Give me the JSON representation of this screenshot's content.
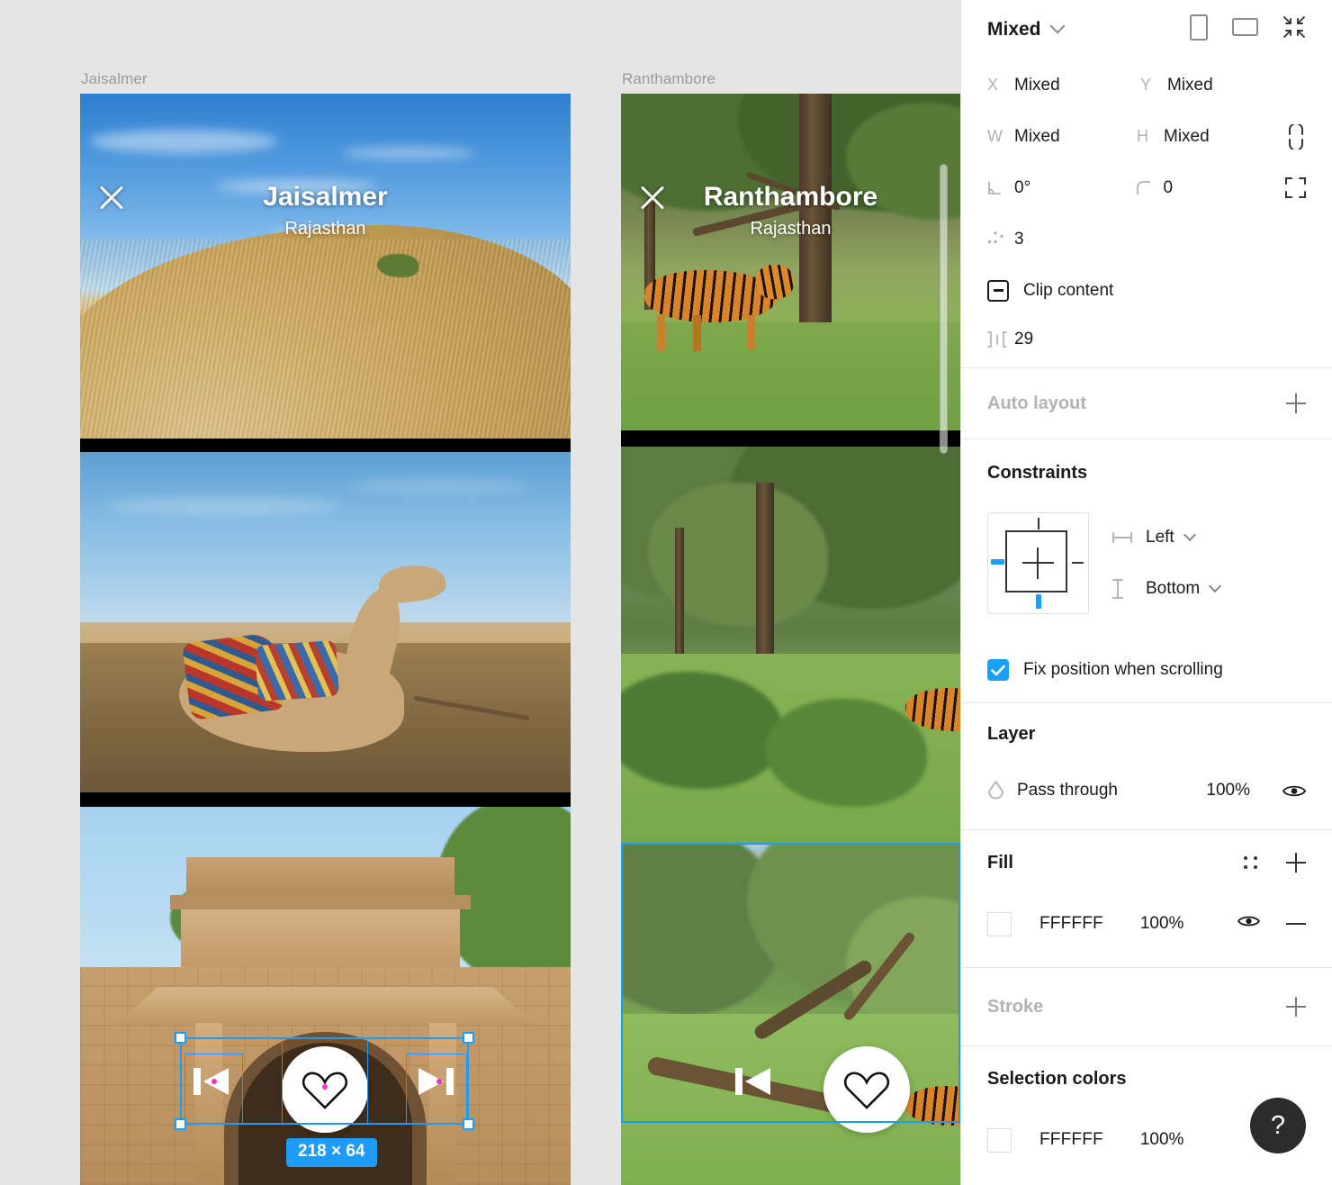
{
  "canvas": {
    "frames": [
      {
        "label": "Jaisalmer",
        "hero_title": "Jaisalmer",
        "hero_subtitle": "Rajasthan"
      },
      {
        "label": "Ranthambore",
        "hero_title": "Ranthambore",
        "hero_subtitle": "Rajasthan"
      }
    ],
    "selection_badge": "218 × 64",
    "accent_color": "#1E9BF5",
    "background_color": "#E5E5E5"
  },
  "panel": {
    "header": {
      "selection_type": "Mixed",
      "orientation_portrait": "portrait-orientation-icon",
      "orientation_landscape": "landscape-orientation-icon",
      "collapse": "collapse-to-fit-icon"
    },
    "transform": {
      "x_label": "X",
      "x_value": "Mixed",
      "y_label": "Y",
      "y_value": "Mixed",
      "w_label": "W",
      "w_value": "Mixed",
      "h_label": "H",
      "h_value": "Mixed",
      "rotation_value": "0°",
      "corner_radius_value": "0",
      "individual_corners_value": "3",
      "proportion_lock": "proportion-unlock-icon",
      "independent_corners": "independent-corners-icon"
    },
    "clip_content": {
      "label": "Clip content",
      "state": "mixed"
    },
    "spacing": {
      "value": "29",
      "icon": "horizontal-spacing-icon"
    },
    "auto_layout": {
      "title": "Auto layout",
      "add": "+"
    },
    "constraints": {
      "title": "Constraints",
      "horizontal": "Left",
      "vertical": "Bottom",
      "fix_position_label": "Fix position when scrolling",
      "fix_position_checked": true
    },
    "layer": {
      "title": "Layer",
      "blend_mode": "Pass through",
      "opacity": "100%",
      "visibility": "visible-eye-icon"
    },
    "fill": {
      "title": "Fill",
      "styles_icon": "color-styles-icon",
      "add": "+",
      "items": [
        {
          "swatch": "#FFFFFF",
          "hex": "FFFFFF",
          "opacity": "100%",
          "visibility": "visible-eye-icon",
          "remove": "−"
        }
      ]
    },
    "stroke": {
      "title": "Stroke",
      "add": "+"
    },
    "selection_colors": {
      "title": "Selection colors",
      "items": [
        {
          "swatch": "#FFFFFF",
          "hex": "FFFFFF",
          "opacity": "100%"
        }
      ]
    },
    "help": {
      "label": "?"
    }
  }
}
